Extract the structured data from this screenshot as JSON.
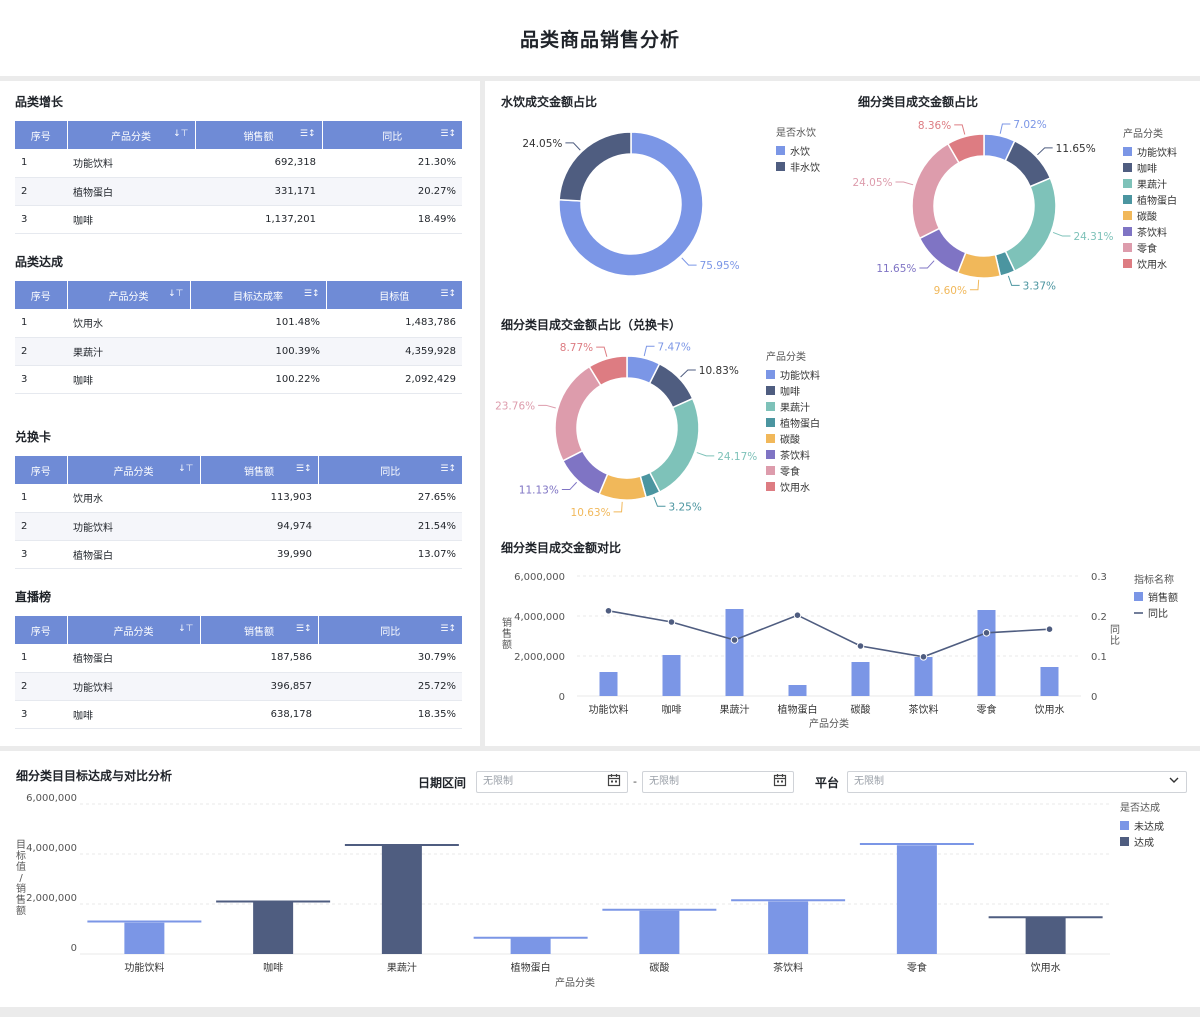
{
  "page": {
    "title": "品类商品销售分析"
  },
  "colors": {
    "header_bg": "#6f8bd6",
    "blue": "#7b96e6",
    "navy": "#4f5d80",
    "teal": "#7ec2b9",
    "dark_teal": "#4b95a0",
    "orange": "#f1b85a",
    "purple": "#7f74c4",
    "pink": "#dd9cac",
    "red": "#dd7c82"
  },
  "tables": [
    {
      "title": "品类增长",
      "columns": [
        "序号",
        "产品分类",
        "销售额",
        "同比"
      ],
      "column_sort_icons": [
        "",
        "↓⊤",
        "☰↕",
        "☰↕"
      ],
      "rows": [
        [
          "1",
          "功能饮料",
          "692,318",
          "21.30%"
        ],
        [
          "2",
          "植物蛋白",
          "331,171",
          "20.27%"
        ],
        [
          "3",
          "咖啡",
          "1,137,201",
          "18.49%"
        ]
      ]
    },
    {
      "title": "品类达成",
      "columns": [
        "序号",
        "产品分类",
        "目标达成率",
        "目标值"
      ],
      "column_sort_icons": [
        "",
        "↓⊤",
        "☰↕",
        "☰↕"
      ],
      "rows": [
        [
          "1",
          "饮用水",
          "101.48%",
          "1,483,786"
        ],
        [
          "2",
          "果蔬汁",
          "100.39%",
          "4,359,928"
        ],
        [
          "3",
          "咖啡",
          "100.22%",
          "2,092,429"
        ]
      ]
    },
    {
      "title": "兑换卡",
      "columns": [
        "序号",
        "产品分类",
        "销售额",
        "同比"
      ],
      "column_sort_icons": [
        "",
        "↓⊤",
        "☰↕",
        "☰↕"
      ],
      "rows": [
        [
          "1",
          "饮用水",
          "113,903",
          "27.65%"
        ],
        [
          "2",
          "功能饮料",
          "94,974",
          "21.54%"
        ],
        [
          "3",
          "植物蛋白",
          "39,990",
          "13.07%"
        ]
      ]
    },
    {
      "title": "直播榜",
      "columns": [
        "序号",
        "产品分类",
        "销售额",
        "同比"
      ],
      "column_sort_icons": [
        "",
        "↓⊤",
        "☰↕",
        "☰↕"
      ],
      "rows": [
        [
          "1",
          "植物蛋白",
          "187,586",
          "30.79%"
        ],
        [
          "2",
          "功能饮料",
          "396,857",
          "25.72%"
        ],
        [
          "3",
          "咖啡",
          "638,178",
          "18.35%"
        ]
      ]
    }
  ],
  "filters": {
    "date_label": "日期区间",
    "date_start_placeholder": "无限制",
    "date_separator": "-",
    "date_end_placeholder": "无限制",
    "platform_label": "平台",
    "platform_value": "无限制"
  },
  "chart_data": [
    {
      "id": "donut-water",
      "type": "pie",
      "title": "水饮成交金额占比",
      "legend_title": "是否水饮",
      "legend_position": "right",
      "slices": [
        {
          "name": "水饮",
          "value": 75.95,
          "label": "75.95%",
          "color": "#7b96e6"
        },
        {
          "name": "非水饮",
          "value": 24.05,
          "label": "24.05%",
          "color": "#4f5d80"
        }
      ]
    },
    {
      "id": "donut-sub",
      "type": "pie",
      "title": "细分类目成交金额占比",
      "legend_title": "产品分类",
      "legend_position": "right",
      "slices": [
        {
          "name": "功能饮料",
          "value": 7.02,
          "label": "7.02%",
          "color": "#7b96e6"
        },
        {
          "name": "咖啡",
          "value": 11.65,
          "label": "11.65%",
          "color": "#4f5d80"
        },
        {
          "name": "果蔬汁",
          "value": 24.31,
          "label": "24.31%",
          "color": "#7ec2b9"
        },
        {
          "name": "植物蛋白",
          "value": 3.37,
          "label": "3.37%",
          "color": "#4b95a0"
        },
        {
          "name": "碳酸",
          "value": 9.6,
          "label": "9.60%",
          "color": "#f1b85a"
        },
        {
          "name": "茶饮料",
          "value": 11.65,
          "label": "11.65%",
          "color": "#7f74c4"
        },
        {
          "name": "零食",
          "value": 24.05,
          "label": "24.05%",
          "color": "#dd9cac"
        },
        {
          "name": "饮用水",
          "value": 8.36,
          "label": "8.36%",
          "color": "#dd7c82"
        }
      ]
    },
    {
      "id": "donut-card",
      "type": "pie",
      "title": "细分类目成交金额占比（兑换卡）",
      "legend_title": "产品分类",
      "legend_position": "right",
      "slices": [
        {
          "name": "功能饮料",
          "value": 7.47,
          "label": "7.47%",
          "color": "#7b96e6"
        },
        {
          "name": "咖啡",
          "value": 10.83,
          "label": "10.83%",
          "color": "#4f5d80"
        },
        {
          "name": "果蔬汁",
          "value": 24.17,
          "label": "24.17%",
          "color": "#7ec2b9"
        },
        {
          "name": "植物蛋白",
          "value": 3.25,
          "label": "3.25%",
          "color": "#4b95a0"
        },
        {
          "name": "碳酸",
          "value": 10.63,
          "label": "10.63%",
          "color": "#f1b85a"
        },
        {
          "name": "茶饮料",
          "value": 11.13,
          "label": "11.13%",
          "color": "#7f74c4"
        },
        {
          "name": "零食",
          "value": 23.76,
          "label": "23.76%",
          "color": "#dd9cac"
        },
        {
          "name": "饮用水",
          "value": 8.77,
          "label": "8.77%",
          "color": "#dd7c82"
        }
      ]
    },
    {
      "id": "combo",
      "type": "bar",
      "title": "细分类目成交金额对比",
      "xlabel": "产品分类",
      "ylabel": "销售额",
      "y2label": "同比",
      "legend_title": "指标名称",
      "legend_position": "right",
      "categories": [
        "功能饮料",
        "咖啡",
        "果蔬汁",
        "植物蛋白",
        "碳酸",
        "茶饮料",
        "零食",
        "饮用水"
      ],
      "ylim": [
        0,
        6000000
      ],
      "yticks": [
        "0",
        "2,000,000",
        "4,000,000",
        "6,000,000"
      ],
      "y2lim": [
        0,
        0.3
      ],
      "y2ticks": [
        "0",
        "0.1",
        "0.2",
        "0.3"
      ],
      "series": [
        {
          "name": "销售额",
          "kind": "bar",
          "color": "#7b96e6",
          "values": [
            1200000,
            2050000,
            4350000,
            550000,
            1700000,
            1950000,
            4300000,
            1450000
          ]
        },
        {
          "name": "同比",
          "kind": "line",
          "color": "#4f5d80",
          "values": [
            0.213,
            0.185,
            0.14,
            0.202,
            0.125,
            0.098,
            0.158,
            0.167
          ]
        }
      ]
    },
    {
      "id": "target",
      "type": "bar",
      "title": "细分类目目标达成与对比分析",
      "xlabel": "产品分类",
      "ylabel": "目标值/销售额",
      "legend_title": "是否达成",
      "legend_position": "right",
      "categories": [
        "功能饮料",
        "咖啡",
        "果蔬汁",
        "植物蛋白",
        "碳酸",
        "茶饮料",
        "零食",
        "饮用水"
      ],
      "ylim": [
        0,
        6000000
      ],
      "yticks": [
        "0",
        "2,000,000",
        "4,000,000",
        "6,000,000"
      ],
      "legend": [
        {
          "name": "未达成",
          "color": "#7b96e6"
        },
        {
          "name": "达成",
          "color": "#4f5d80"
        }
      ],
      "values": [
        1250000,
        2120000,
        4370000,
        620000,
        1730000,
        2100000,
        4350000,
        1490000
      ],
      "targets": [
        1300000,
        2100000,
        4360000,
        650000,
        1770000,
        2150000,
        4400000,
        1470000
      ],
      "achieved": [
        false,
        true,
        true,
        false,
        false,
        false,
        false,
        true
      ]
    }
  ]
}
